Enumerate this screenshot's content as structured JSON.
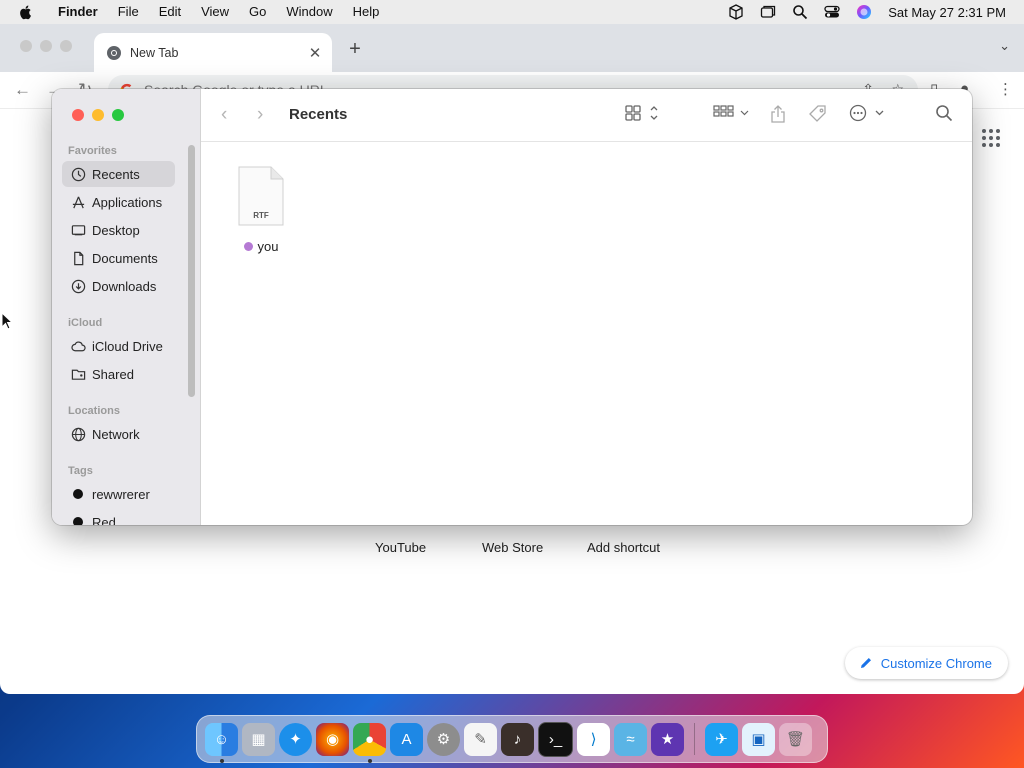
{
  "menubar": {
    "app_name": "Finder",
    "items": [
      "File",
      "Edit",
      "View",
      "Go",
      "Window",
      "Help"
    ],
    "clock": "Sat May 27  2:31 PM",
    "status_icons": [
      "box-icon",
      "window-icon",
      "spotlight-icon",
      "control-center-icon",
      "siri-icon"
    ]
  },
  "chrome": {
    "tab_title": "New Tab",
    "omnibox_placeholder": "Search Google or type a URL",
    "shortcuts": [
      "YouTube",
      "Web Store",
      "Add shortcut"
    ],
    "customize_label": "Customize Chrome"
  },
  "finder": {
    "title": "Recents",
    "sidebar": {
      "favorites_header": "Favorites",
      "favorites": [
        {
          "label": "Recents",
          "icon": "clock-icon",
          "selected": true
        },
        {
          "label": "Applications",
          "icon": "applications-icon"
        },
        {
          "label": "Desktop",
          "icon": "desktop-icon"
        },
        {
          "label": "Documents",
          "icon": "document-icon"
        },
        {
          "label": "Downloads",
          "icon": "download-icon"
        }
      ],
      "icloud_header": "iCloud",
      "icloud": [
        {
          "label": "iCloud Drive",
          "icon": "cloud-icon"
        },
        {
          "label": "Shared",
          "icon": "shared-folder-icon"
        }
      ],
      "locations_header": "Locations",
      "locations": [
        {
          "label": "Network",
          "icon": "globe-icon"
        }
      ],
      "tags_header": "Tags",
      "tags": [
        {
          "label": "rewwrerer",
          "color": "#111111"
        },
        {
          "label": "Red",
          "color": "#111111"
        }
      ]
    },
    "files": [
      {
        "name": "you",
        "type_label": "RTF",
        "tag_color": "#b57ad4"
      }
    ]
  },
  "dock": {
    "apps": [
      "Finder",
      "Launchpad",
      "Safari",
      "Firefox",
      "Google Chrome",
      "App Store",
      "System Settings",
      "TextEdit",
      "GarageBand",
      "Terminal",
      "Visual Studio Code",
      "Dolphin",
      "iMovie",
      "Twitter",
      "Preview",
      "Trash"
    ]
  }
}
